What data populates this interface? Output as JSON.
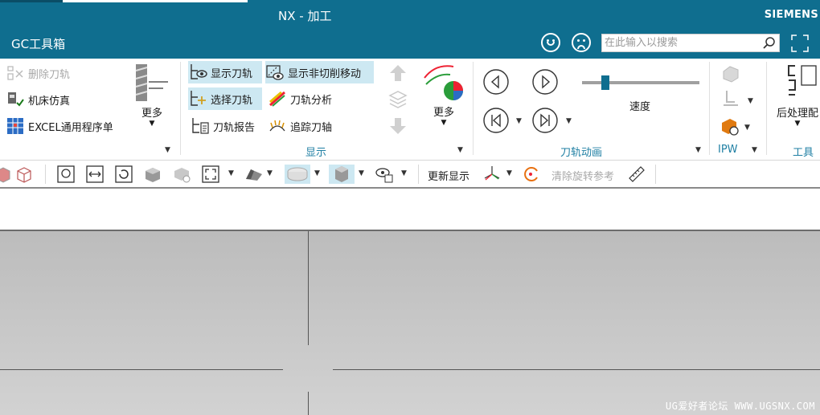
{
  "titlebar": {
    "app_title": "NX - 加工",
    "brand": "SIEMENS",
    "toolbox_label": "GC工具箱",
    "search_placeholder": "在此输入以搜索",
    "bg_color": "#0f6e8f"
  },
  "ribbon": {
    "left_group": {
      "items": [
        {
          "label": "删除刀轨",
          "enabled": false,
          "icon": "delete-toolpath-icon"
        },
        {
          "label": "机床仿真",
          "enabled": true,
          "icon": "machine-simulation-icon"
        },
        {
          "label": "EXCEL通用程序单",
          "enabled": true,
          "icon": "excel-sheet-icon"
        }
      ],
      "more_label": "更多"
    },
    "display_group": {
      "label": "显示",
      "items": [
        {
          "label": "显示刀轨",
          "active": true
        },
        {
          "label": "显示非切削移动",
          "active": true
        },
        {
          "label": "选择刀轨",
          "active": true
        },
        {
          "label": "刀轨分析",
          "active": false
        },
        {
          "label": "刀轨报告",
          "active": false
        },
        {
          "label": "追踪刀轴",
          "active": false
        }
      ],
      "more_label": "更多"
    },
    "animation_group": {
      "label": "刀轨动画",
      "speed_label": "速度",
      "speed_fraction": 0.2
    },
    "ipw_group": {
      "label": "IPW"
    },
    "tools_group": {
      "label": "工具",
      "postprocess_label": "后处理配"
    }
  },
  "quick_toolbar": {
    "update_display": "更新显示",
    "clear_rotation_ref": "清除旋转参考"
  },
  "viewport": {
    "watermark": "UG爱好者论坛 WWW.UGSNX.COM",
    "bg_color": "#c4c4c4"
  }
}
